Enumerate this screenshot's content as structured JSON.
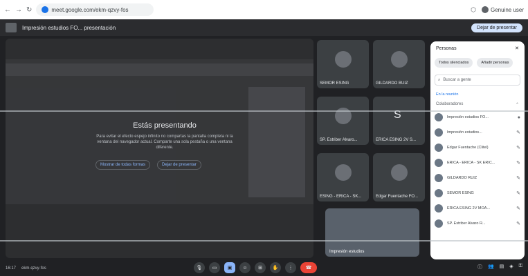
{
  "browser": {
    "url": "meet.google.com/ekm-qzvy-fos",
    "account": "Genuine user"
  },
  "meeting": {
    "title": "Impresión estudios FO... presentación",
    "stop_presenting": "Dejar de presentar"
  },
  "presenting": {
    "heading": "Estás presentando",
    "description": "Para evitar el efecto espejo infinito no compartas la pantalla completa ni la ventana del navegador actual. Comparte una sola pestaña o una ventana diferente.",
    "show_button": "Mostrar de todas formas",
    "stop_button": "Dejar de presentar"
  },
  "tiles": [
    {
      "name": "SEMOR ESING",
      "letter": ""
    },
    {
      "name": "GILDARDO BUIZ",
      "letter": ""
    },
    {
      "name": "SP. Estriber Alvaro...",
      "letter": ""
    },
    {
      "name": "ERICA ESING 2V S...",
      "letter": "S"
    },
    {
      "name": "ESING - ERICA - SK...",
      "letter": ""
    },
    {
      "name": "Edgar Fuentache FO...",
      "letter": ""
    }
  ],
  "self_view": {
    "name": "Impresión estudios"
  },
  "people": {
    "title": "Personas",
    "chips": [
      "Todos silenciados",
      "Añadir personas"
    ],
    "search_placeholder": "Buscar a gente",
    "section_label": "En la reunión",
    "group_label": "Colaboradores",
    "participants": [
      {
        "name": "Impresión estudios FO..."
      },
      {
        "name": "Impresión estudios..."
      },
      {
        "name": "Edgar Fuentache (Clitel)"
      },
      {
        "name": "ERICA - ERICA - SK ERIC..."
      },
      {
        "name": "GILDARDO RUIZ"
      },
      {
        "name": "SEMOR ESING"
      },
      {
        "name": "ERICA ESING 2V MOA..."
      },
      {
        "name": "SP. Estriber Alvaro R..."
      }
    ]
  },
  "bottom": {
    "time": "16:17",
    "meeting_code": "ekm-qzvy-fos"
  },
  "icons": {
    "close": "close-icon",
    "search": "search-icon",
    "mic": "mic-icon",
    "camera": "camera-icon",
    "present": "present-icon",
    "hangup": "hangup-icon"
  }
}
